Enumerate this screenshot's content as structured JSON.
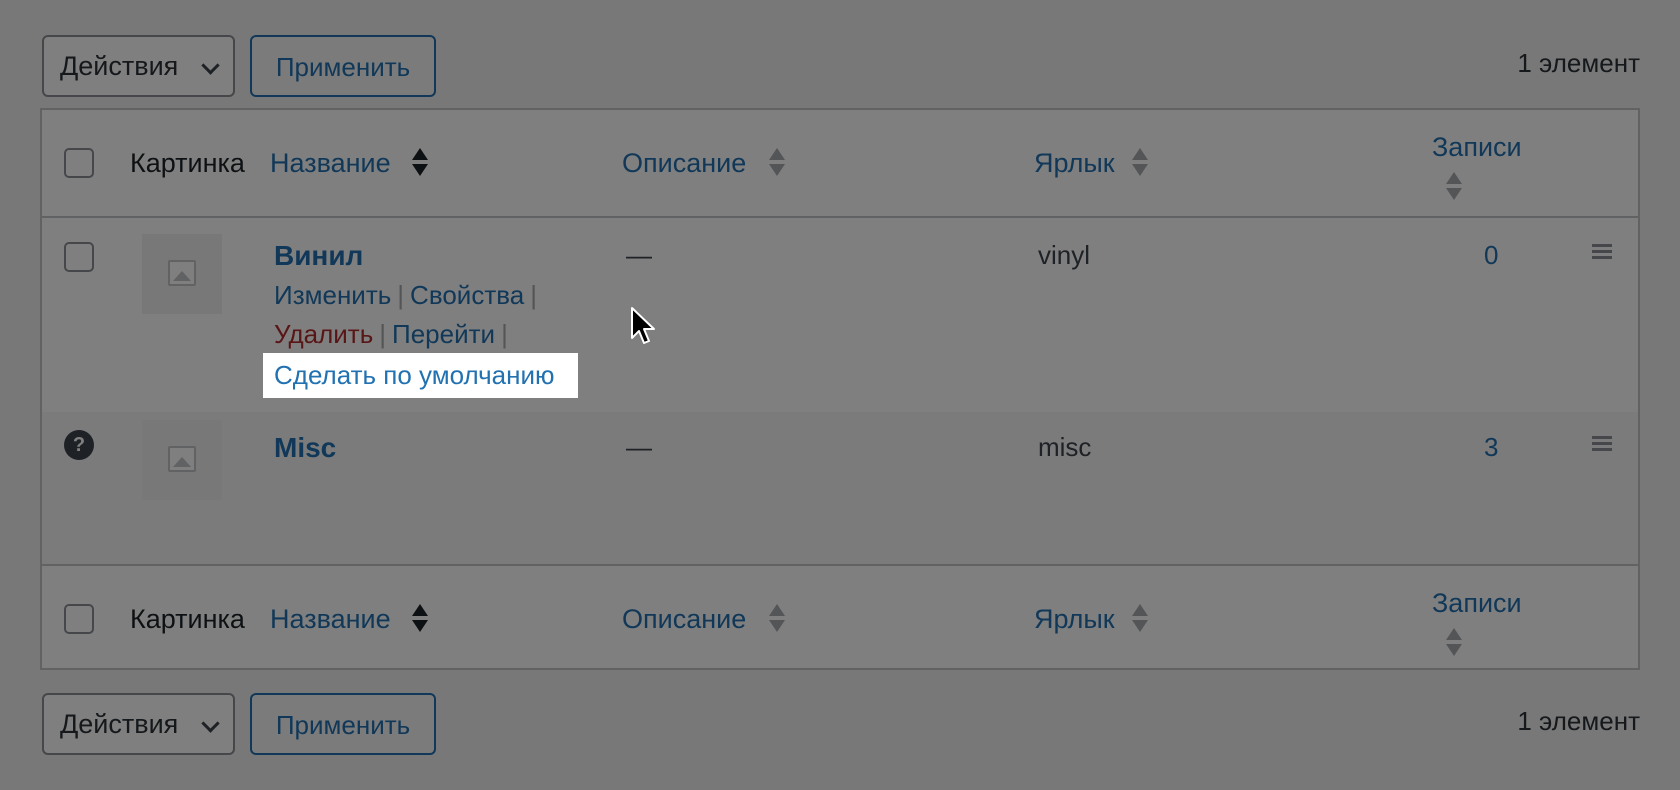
{
  "toolbar": {
    "bulk_actions_label": "Действия",
    "apply_label": "Применить",
    "item_count": "1 элемент"
  },
  "table": {
    "columns": {
      "image": "Картинка",
      "name": "Название",
      "description": "Описание",
      "slug": "Ярлык",
      "count": "Записи"
    },
    "rows": [
      {
        "name": "Винил",
        "description": "—",
        "slug": "vinyl",
        "count": "0",
        "actions": {
          "edit": "Изменить",
          "quick_edit": "Свойства",
          "delete": "Удалить",
          "view": "Перейти",
          "make_default": "Сделать по умолчанию"
        }
      },
      {
        "name": "Misc",
        "description": "—",
        "slug": "misc",
        "count": "3",
        "status_icon": "?"
      }
    ]
  },
  "colors": {
    "link": "#2271b1",
    "delete": "#b32d2e",
    "overlay": "rgba(0,0,0,0.5)"
  }
}
